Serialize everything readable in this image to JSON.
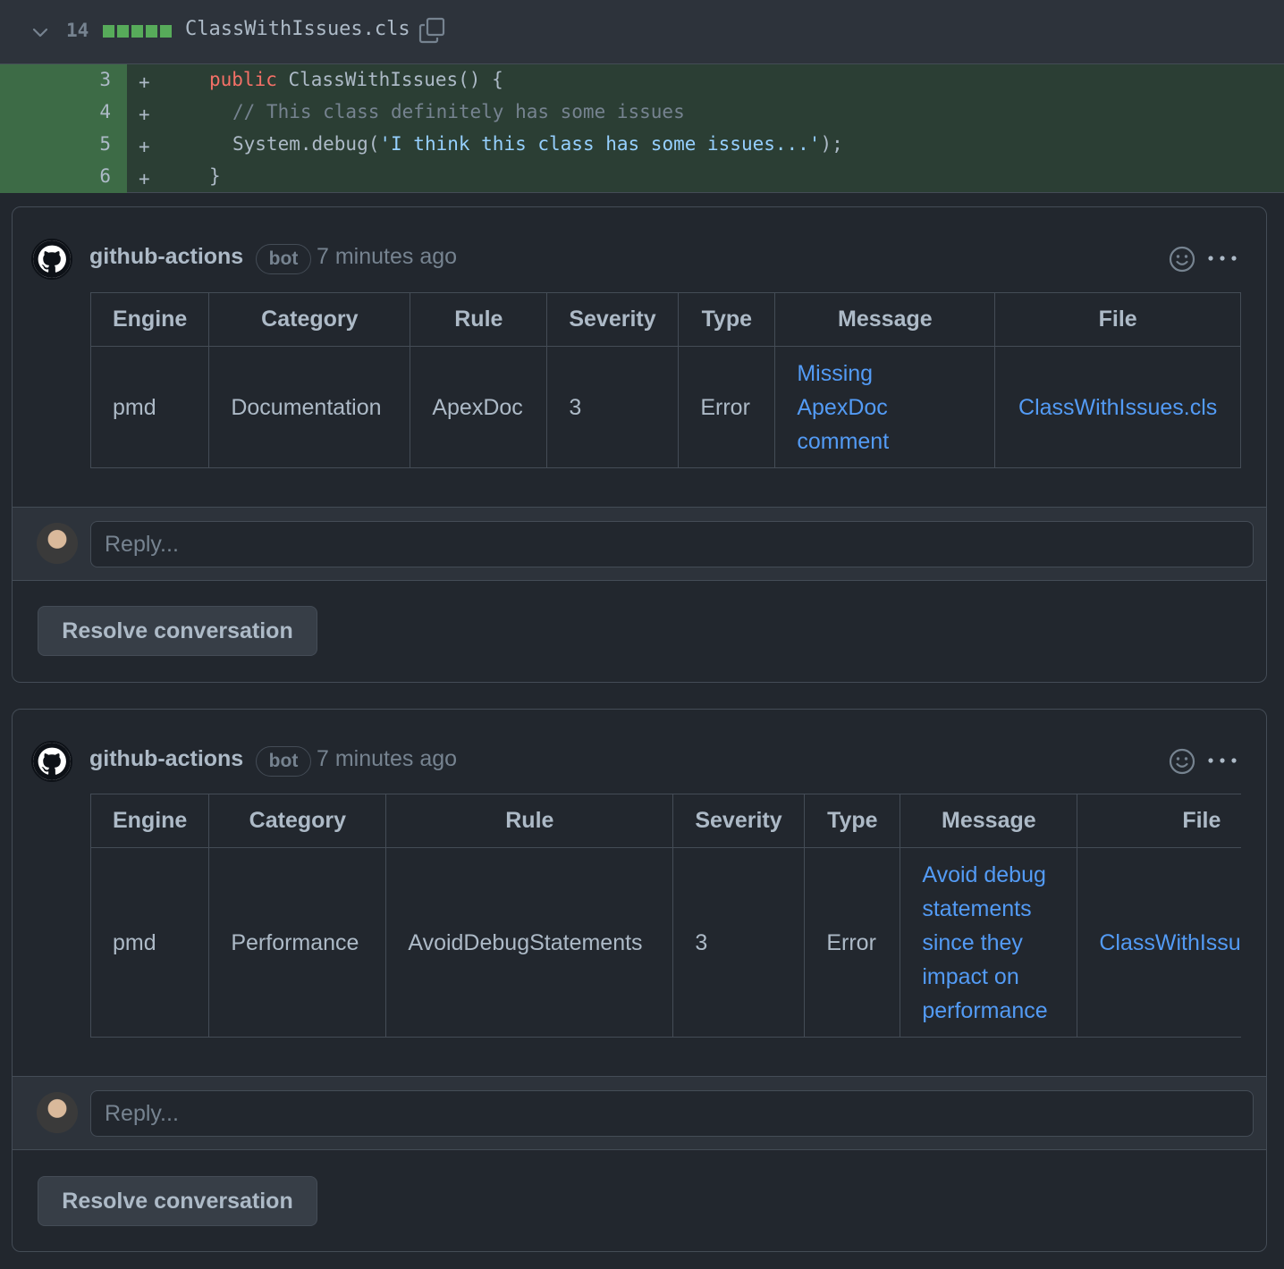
{
  "file": {
    "changes": "14",
    "name": "ClassWithIssues.cls"
  },
  "diff": {
    "lines": [
      {
        "num": "3",
        "marker": "+"
      },
      {
        "num": "4",
        "marker": "+"
      },
      {
        "num": "5",
        "marker": "+"
      },
      {
        "num": "6",
        "marker": "+"
      }
    ],
    "code": {
      "l3_kw": "public",
      "l3_rest": " ClassWithIssues() {",
      "l4_comment": "// This class definitely has some issues",
      "l5_pre": "System.debug(",
      "l5_str": "'I think this class has some issues...'",
      "l5_post": ");",
      "l6": "}"
    }
  },
  "threads": [
    {
      "author": "github-actions",
      "badge": "bot",
      "time": "7 minutes ago",
      "headers": [
        "Engine",
        "Category",
        "Rule",
        "Severity",
        "Type",
        "Message",
        "File"
      ],
      "row": {
        "engine": "pmd",
        "category": "Documentation",
        "rule": "ApexDoc",
        "severity": "3",
        "type": "Error",
        "message_lines": [
          "Missing",
          "ApexDoc",
          "comment"
        ],
        "file": "ClassWithIssues.cls"
      },
      "reply_placeholder": "Reply...",
      "resolve_label": "Resolve conversation"
    },
    {
      "author": "github-actions",
      "badge": "bot",
      "time": "7 minutes ago",
      "headers": [
        "Engine",
        "Category",
        "Rule",
        "Severity",
        "Type",
        "Message",
        "File"
      ],
      "row": {
        "engine": "pmd",
        "category": "Performance",
        "rule": "AvoidDebugStatements",
        "severity": "3",
        "type": "Error",
        "message_lines": [
          "Avoid debug",
          "statements",
          "since they",
          "impact on",
          "performance"
        ],
        "file": "ClassWithIssu"
      },
      "reply_placeholder": "Reply...",
      "resolve_label": "Resolve conversation"
    }
  ],
  "colors": {
    "background": "#22272e",
    "added_line": "#2b3e34",
    "added_gutter": "#3d6b46",
    "link": "#539bf5",
    "keyword": "#f47067",
    "string": "#96d0ff"
  }
}
